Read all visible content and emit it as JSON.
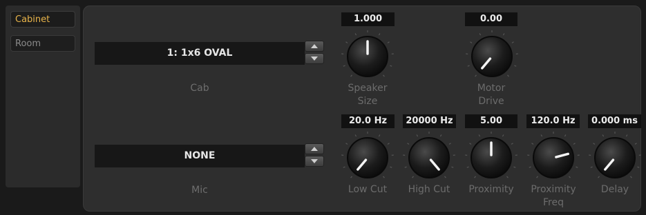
{
  "sidebar": {
    "tabs": [
      {
        "label": "Cabinet",
        "active": true
      },
      {
        "label": "Room",
        "active": false
      }
    ]
  },
  "cab": {
    "value": "1: 1x6 OVAL",
    "label": "Cab"
  },
  "mic": {
    "value": "NONE",
    "label": "Mic"
  },
  "knobs": {
    "speaker_size": {
      "readout": "1.000",
      "label_line1": "Speaker",
      "label_line2": "Size",
      "angle": 0
    },
    "motor_drive": {
      "readout": "0.00",
      "label_line1": "Motor",
      "label_line2": "Drive",
      "angle": -140
    },
    "low_cut": {
      "readout": "20.0 Hz",
      "label_line1": "Low Cut",
      "label_line2": "",
      "angle": -140
    },
    "high_cut": {
      "readout": "20000 Hz",
      "label_line1": "High Cut",
      "label_line2": "",
      "angle": 140
    },
    "proximity": {
      "readout": "5.00",
      "label_line1": "Proximity",
      "label_line2": "",
      "angle": 0
    },
    "proximity_freq": {
      "readout": "120.0 Hz",
      "label_line1": "Proximity",
      "label_line2": "Freq",
      "angle": 75
    },
    "delay": {
      "readout": "0.000 ms",
      "label_line1": "Delay",
      "label_line2": "",
      "angle": -140
    }
  },
  "colors": {
    "accent": "#e8b44a",
    "panel": "#2e2e2e",
    "background": "#1a1a1a"
  }
}
